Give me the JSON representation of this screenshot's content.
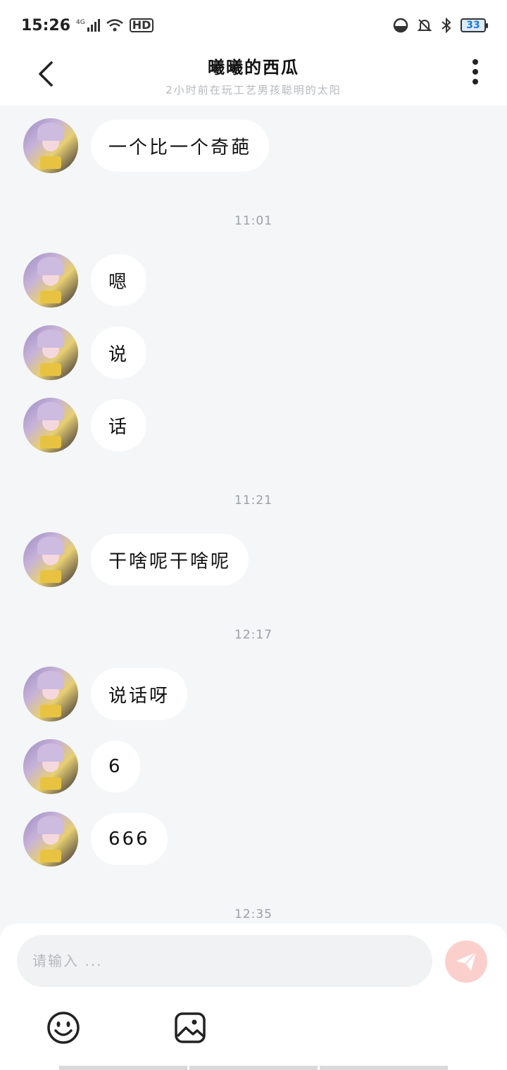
{
  "status": {
    "time": "15:26",
    "network": "4G",
    "hd": "HD",
    "battery": "33"
  },
  "header": {
    "title": "曦曦的西瓜",
    "subtitle": "2小时前在玩工艺男孩聪明的太阳"
  },
  "messages": [
    "一个比一个奇葩",
    "嗯",
    "说",
    "话",
    "干啥呢干啥呢",
    "说话呀",
    "6",
    "666"
  ],
  "timestamps": [
    "11:01",
    "11:21",
    "12:17",
    "12:35"
  ],
  "input": {
    "placeholder": "请输入 ..."
  },
  "colors": {
    "background": "#f4f6f7",
    "bubble": "#ffffff",
    "send_button": "#fbd0cc",
    "subtitle": "#b5b8bc"
  },
  "icons": [
    "back-icon",
    "more-icon",
    "send-icon",
    "emoji-icon",
    "image-icon"
  ]
}
